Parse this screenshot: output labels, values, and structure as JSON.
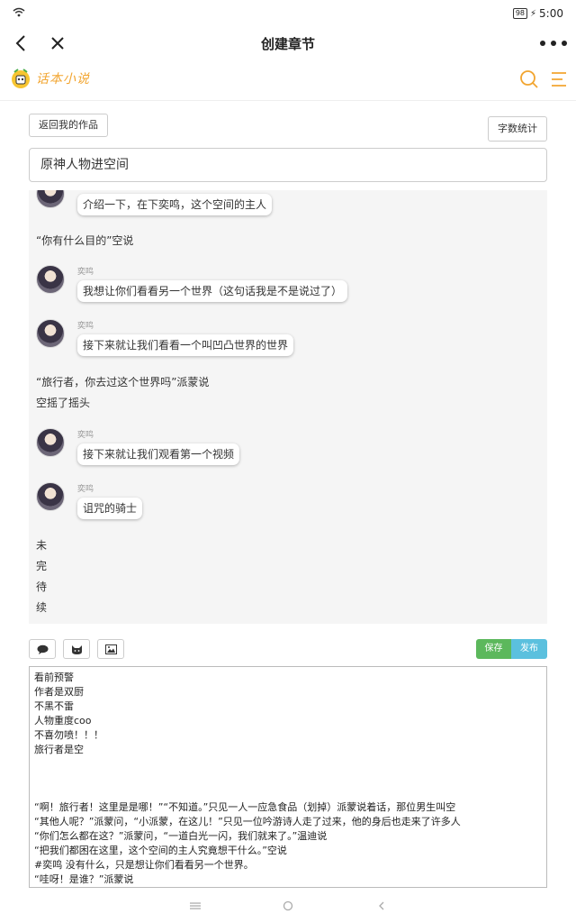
{
  "status": {
    "battery": "98",
    "time": "5:00"
  },
  "titlebar": {
    "title": "创建章节"
  },
  "toolbar": {
    "return_label": "返回我的作品",
    "wordcount_label": "字数统计",
    "save_label": "保存",
    "publish_label": "发布"
  },
  "chapter": {
    "title": "原神人物进空间"
  },
  "preview": {
    "msg0_text": "介绍一下，在下奕鸣，这个空间的主人",
    "narr1": "“你有什么目的”空说",
    "msg1_name": "奕鸣",
    "msg1_text": "我想让你们看看另一个世界（这句话我是不是说过了）",
    "msg2_name": "奕鸣",
    "msg2_text": "接下来就让我们看看一个叫凹凸世界的世界",
    "narr2_line1": "“旅行者，你去过这个世界吗”派蒙说",
    "narr2_line2": "空摇了摇头",
    "msg3_name": "奕鸣",
    "msg3_text": "接下来就让我们观看第一个视频",
    "msg4_name": "奕鸣",
    "msg4_text": "诅咒的骑士",
    "end1": "未",
    "end2": "完",
    "end3": "待",
    "end4": "续"
  },
  "editor": {
    "lines": [
      "看前预警",
      "作者是双厨",
      "不黑不雷",
      "人物重度coo",
      "不喜勿喷！！！",
      "旅行者是空",
      "",
      "",
      "",
      "“啊！旅行者！这里是是哪！”“不知道。”只见一人一应急食品（划掉）派蒙说着话，那位男生叫空",
      "“其他人呢？”派蒙问，“小派蒙，在这儿！”只见一位吟游诗人走了过来，他的身后也走来了许多人",
      "“你们怎么都在这？”派蒙问，“一道白光一闪，我们就来了。”温迪说",
      "“把我们都困在这里，这个空间的主人究竟想干什么。”空说",
      "#奕鸣 没有什么，只是想让你们看看另一个世界。",
      "“哇呀！是谁？”派蒙说"
    ]
  },
  "icons": {
    "back": "chevron-left-icon",
    "close": "close-icon",
    "more": "more-dots-icon",
    "search": "search-icon",
    "menu": "menu-icon",
    "chat": "chat-bubble-icon",
    "emoji": "cat-face-icon",
    "image": "image-icon"
  },
  "colors": {
    "accent": "#f2a530",
    "save": "#5cb85c",
    "publish": "#5bc0de",
    "preview_bg": "#f5f5f5"
  }
}
